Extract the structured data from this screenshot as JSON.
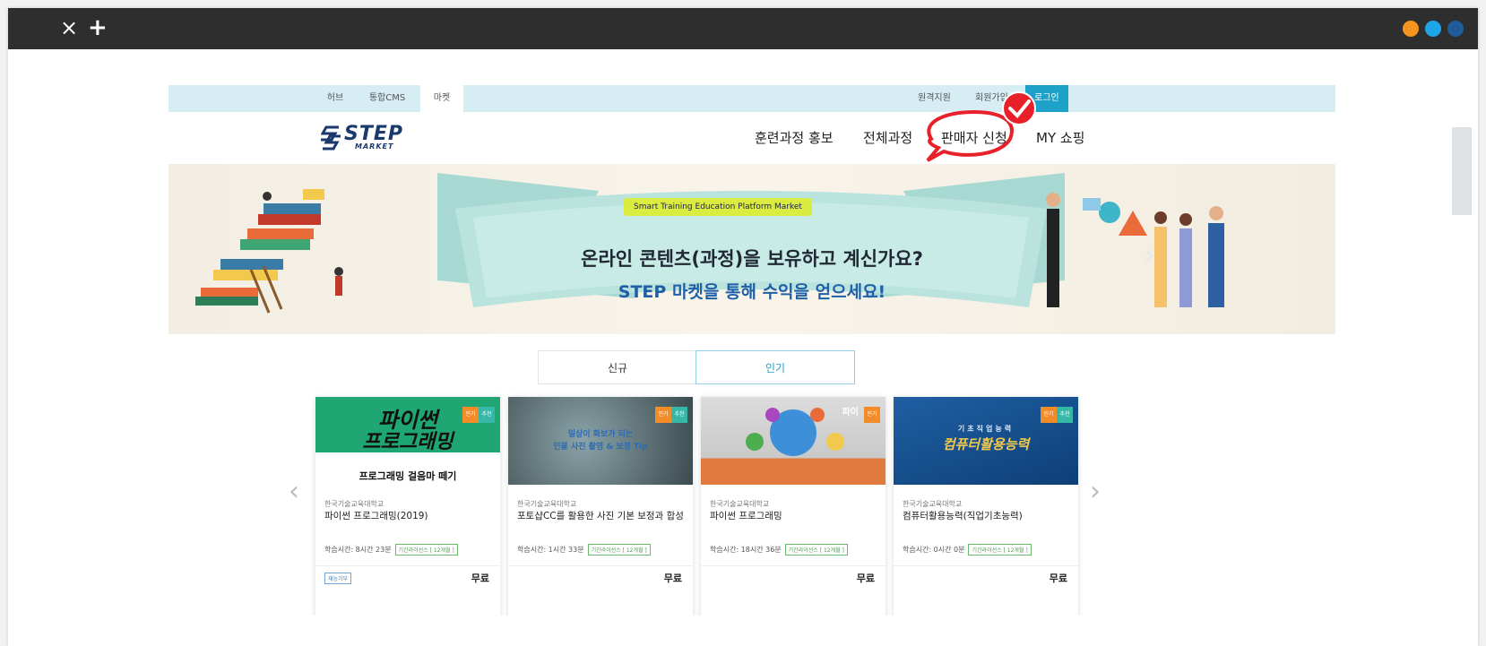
{
  "browser": {
    "close_icon": "×",
    "new_tab_icon": "+",
    "dots": [
      "#f7941d",
      "#1ea5e8",
      "#1f5d9a"
    ]
  },
  "site": {
    "util_tabs": [
      "허브",
      "통합CMS",
      "마켓"
    ],
    "util_links": [
      "원격지원",
      "회원가입"
    ],
    "login_label": "로그인",
    "logo": {
      "text": "STEP",
      "sub": "MARKET"
    },
    "nav": [
      "훈련과정 홍보",
      "전체과정",
      "판매자 신청",
      "MY 쇼핑"
    ]
  },
  "banner": {
    "badge": "Smart Training Education Platform Market",
    "line1": "온라인 콘텐츠(과정)을 보유하고 계신가요?",
    "line2": "STEP 마켓을 통해 수익을 얻으세요!"
  },
  "list_tabs": [
    "신규",
    "인기"
  ],
  "carousel": {
    "prev_icon": "‹",
    "next_icon": "›"
  },
  "cards": [
    {
      "thumb_line1": "파이썬",
      "thumb_line2": "프로그래밍",
      "thumb_line3": "프로그래밍 걸음마 떼기",
      "badges": [
        "인기",
        "추천"
      ],
      "institution": "한국기술교육대학교",
      "title": "파이썬 프로그래밍(2019)",
      "time": "학습시간: 8시간 23분",
      "license": "기간라이선스 [ 12개월 ]",
      "tag": "재능기부",
      "price": "무료"
    },
    {
      "thumb_line1": "일상이 화보가 되는",
      "thumb_line2": "인물 사진 촬영 & 보정 Tip",
      "badges": [
        "인기",
        "추천"
      ],
      "institution": "한국기술교육대학교",
      "title": "포토샵CC를 활용한 사진 기본 보정과 합성",
      "time": "학습시간: 1시간 33분",
      "license": "기간라이선스 [ 12개월 ]",
      "price": "무료"
    },
    {
      "thumb_line1": "파이",
      "badges": [
        "인기"
      ],
      "institution": "한국기술교육대학교",
      "title": "파이썬 프로그래밍",
      "time": "학습시간: 18시간 36분",
      "license": "기간라이선스 [ 12개월 ]",
      "price": "무료"
    },
    {
      "thumb_line1": "기초직업능력",
      "thumb_line2": "컴퓨터활용능력",
      "badges": [
        "인기",
        "추천"
      ],
      "institution": "한국기술교육대학교",
      "title": "컴퓨터활용능력(직업기초능력)",
      "time": "학습시간: 0시간 0분",
      "license": "기간라이선스 [ 12개월 ]",
      "price": "무료"
    }
  ],
  "colors": {
    "accent": "#1ea1c9",
    "util_bar": "#d6edf4",
    "annotation": "#e8202a",
    "badge_orange": "#f28c28",
    "badge_teal": "#36b7a8"
  }
}
